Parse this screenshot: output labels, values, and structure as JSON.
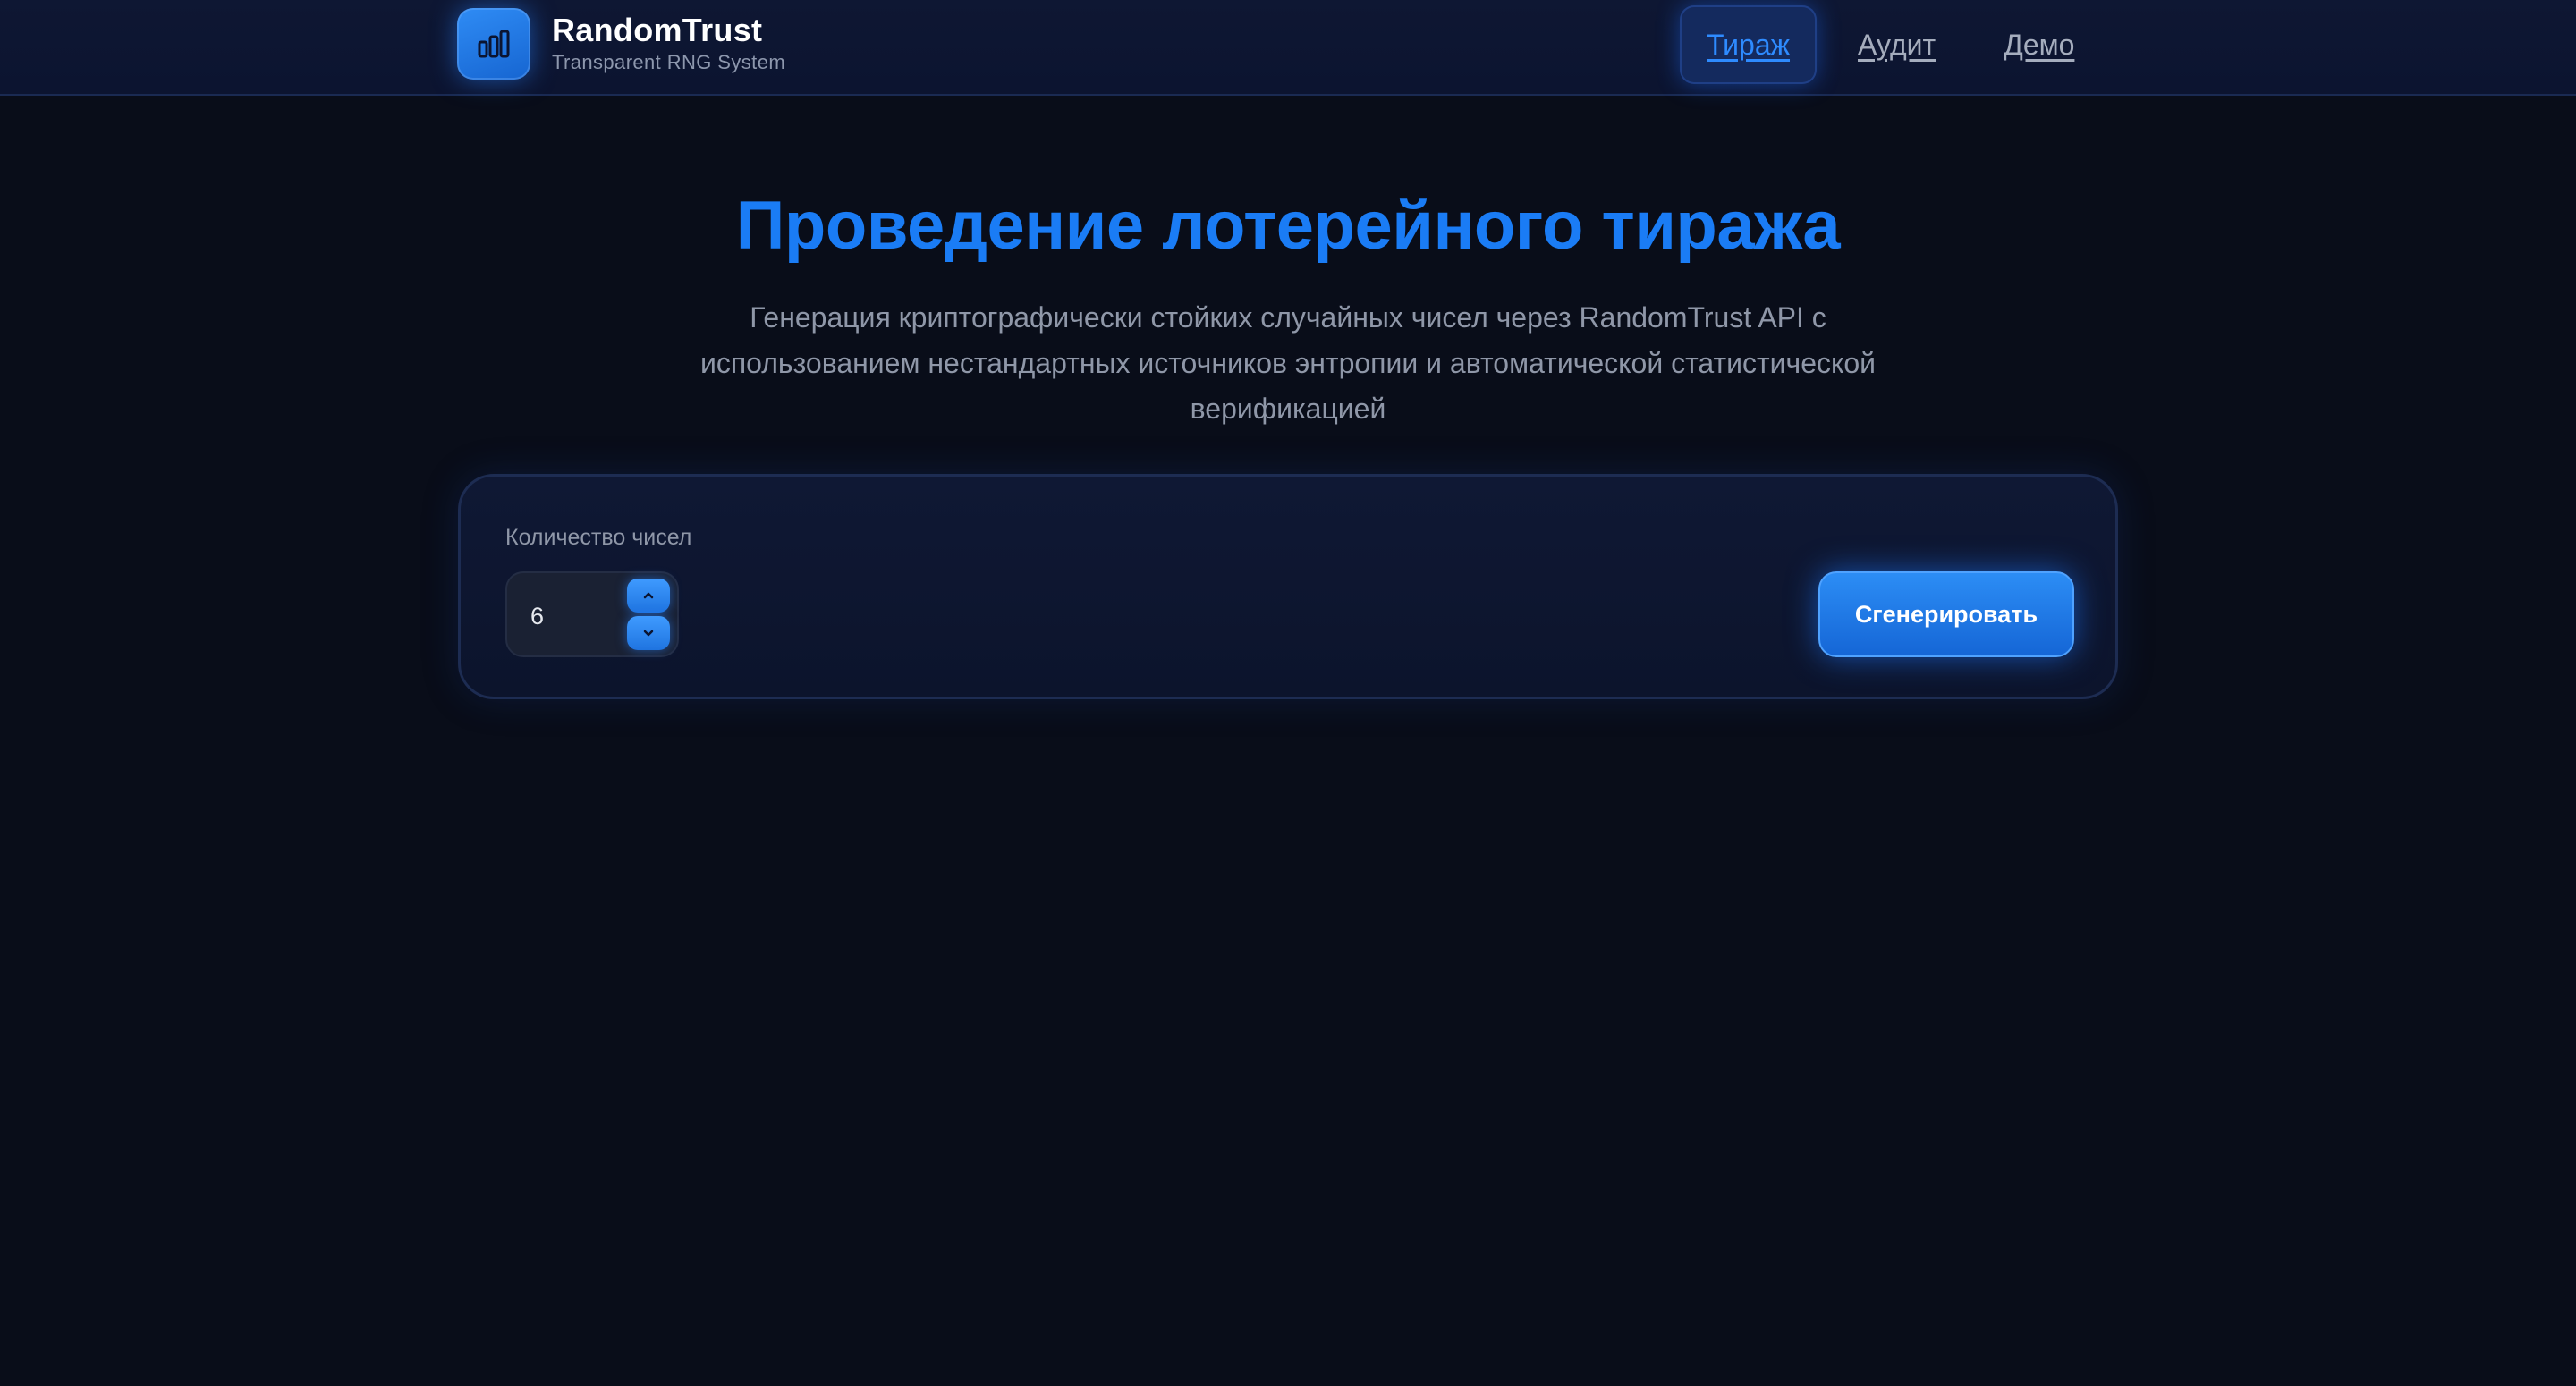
{
  "header": {
    "app_name": "RandomTrust",
    "app_subtitle": "Transparent RNG System",
    "logo_icon": "bar-chart-icon",
    "nav": [
      {
        "label": "Тираж",
        "active": true
      },
      {
        "label": "Аудит",
        "active": false
      },
      {
        "label": "Демо",
        "active": false
      }
    ]
  },
  "main": {
    "title": "Проведение лотерейного тиража",
    "description": "Генерация криптографически стойких случайных чисел через RandomTrust API с использованием нестандартных источников энтропии и автоматической статистической верификацией"
  },
  "form": {
    "count_label": "Количество чисел",
    "count_value": "6",
    "generate_label": "Сгенерировать"
  },
  "colors": {
    "background": "#090d19",
    "accent": "#1a7cf5",
    "header_bg": "#0e1733"
  }
}
